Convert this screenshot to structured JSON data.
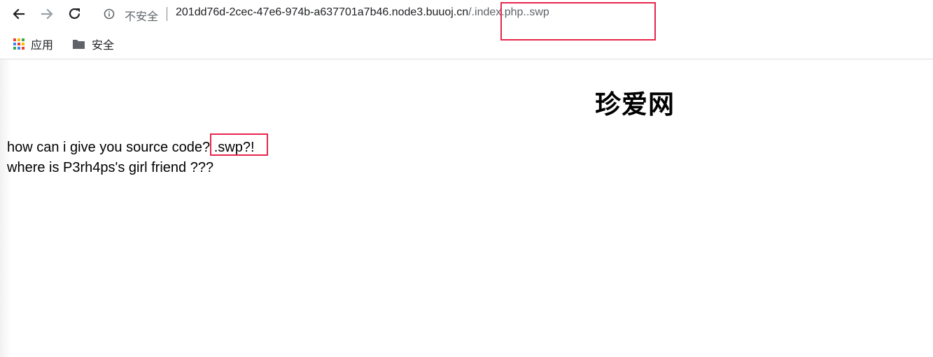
{
  "toolbar": {
    "back_icon": "arrow-left-icon",
    "forward_icon": "arrow-right-icon",
    "reload_icon": "reload-icon",
    "security_icon": "info-circle-icon",
    "insecure_label": "不安全",
    "url_host": "201dd76d-2cec-47e6-974b-a637701a7b46.node3.buuoj.cn",
    "url_path": "/.index.php..swp"
  },
  "bookmarks": {
    "apps_label": "应用",
    "folder_label": "安全",
    "apps_colors": [
      "#ea4335",
      "#fbbc04",
      "#34a853",
      "#4285f4",
      "#ea4335",
      "#fbbc04",
      "#34a853",
      "#4285f4",
      "#ea4335"
    ]
  },
  "page": {
    "title": "珍爱网",
    "line1": "how can i give you source code? .swp?!",
    "line2": "where is P3rh4ps's girl friend ???"
  },
  "annotation_color": "#e8254d"
}
